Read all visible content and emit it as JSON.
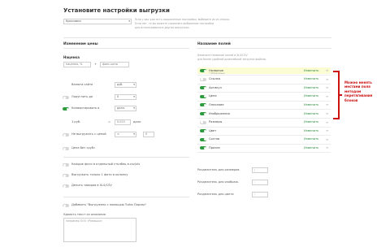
{
  "header": {
    "title": "Установите настройки выгрузки",
    "preset_select": "Кроссовки",
    "preset_hint": [
      "Если у вас уже есть сохраненные настройки, выберите их из списка.",
      "Если нет, то вы можете сохранить выбранные настройки",
      "для использования в других выгрузках."
    ]
  },
  "price": {
    "title": "Изменение цены",
    "formula_label": "Наценка",
    "markup_input": "наценка, %",
    "plus": "+",
    "fixed_input": "фикс.цена",
    "currency_label": "Валюта сайта",
    "currency_value": "руб.",
    "round_label": "Округлить до",
    "round_value": "0",
    "convert_label": "Конвертировать в",
    "convert_value": "долл.",
    "rate_label": "1 руб.",
    "rate_eq": "=",
    "rate_value": "0.013",
    "rate_unit": "долл.",
    "hide_price_label": "Не выгружать с ценой",
    "hide_price_op": "<",
    "hide_price_value": "0",
    "price_no_rub_label": "Цена без «руб»"
  },
  "photo": {
    "each_photo": "Каждое фото в отдельный столбец в.csv/xls",
    "one_photo": "Выгружать только 1 фото в колонку",
    "split_products": "Делить товаров в XLS/CSV"
  },
  "extra": {
    "add_export": "Добавить \"Выгружено с помощью Turbo Парсер\"",
    "remove_text": "Удалить текст из описания",
    "textarea_placeholder": "например ООО «Ромашка»"
  },
  "fields": {
    "title": "Название полей",
    "hint": [
      "Измените название полей в XLS/CSV",
      "для более удобной дальнейшей загрузки файлов."
    ],
    "change_label": "Изменить",
    "items": [
      {
        "name": "Название",
        "sub": "* Обязательно",
        "on": true,
        "highlight": true
      },
      {
        "name": "Ссылка",
        "on": false
      },
      {
        "name": "Артикул",
        "on": true
      },
      {
        "name": "Цена",
        "on": true
      },
      {
        "name": "Описание",
        "on": true
      },
      {
        "name": "Изображения",
        "on": true
      },
      {
        "name": "Размеры",
        "on": false
      },
      {
        "name": "Цвет",
        "on": true
      },
      {
        "name": "Состав",
        "on": true
      },
      {
        "name": "Прочее",
        "on": true
      }
    ],
    "sep_sizes": "Разделитель для размеров",
    "sep_sizes_val": ";",
    "sep_images": "Разделитель для изображ.",
    "sep_images_val": ";",
    "sep_colors": "Разделитель для цвета",
    "sep_colors_val": ";"
  },
  "annotation": {
    "text": [
      "Можно менять",
      "местами поля",
      "методом",
      "перетягивания",
      "блоков"
    ]
  },
  "colors": {
    "accent": "#2e9b3e",
    "annotation": "#cc1111",
    "highlight": "#fbfbd4"
  }
}
